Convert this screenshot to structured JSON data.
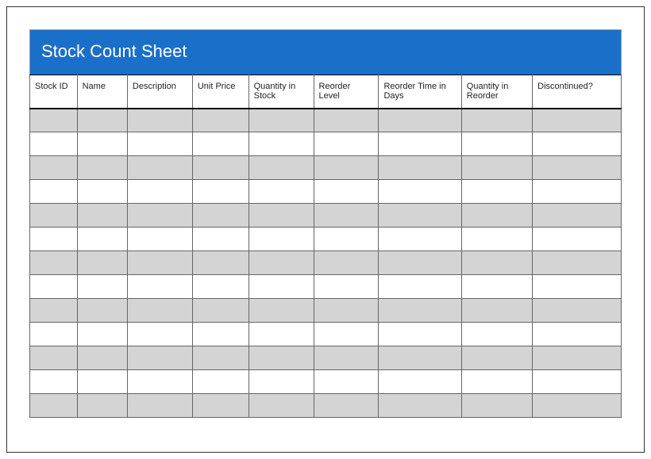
{
  "title": "Stock Count Sheet",
  "columns": [
    {
      "key": "stock_id",
      "label": "Stock ID"
    },
    {
      "key": "name",
      "label": "Name"
    },
    {
      "key": "description",
      "label": "Description"
    },
    {
      "key": "unit_price",
      "label": "Unit Price"
    },
    {
      "key": "qty_in_stock",
      "label": "Quantity in Stock"
    },
    {
      "key": "reorder_level",
      "label": "Reorder Level"
    },
    {
      "key": "reorder_time_days",
      "label": "Reorder Time in Days"
    },
    {
      "key": "qty_in_reorder",
      "label": "Quantity in Reorder"
    },
    {
      "key": "discontinued",
      "label": "Discontinued?"
    }
  ],
  "rows": [
    {},
    {},
    {},
    {},
    {},
    {},
    {},
    {},
    {},
    {},
    {},
    {},
    {}
  ],
  "colors": {
    "title_bg": "#1a6fc9",
    "shade_bg": "#d4d4d4"
  }
}
